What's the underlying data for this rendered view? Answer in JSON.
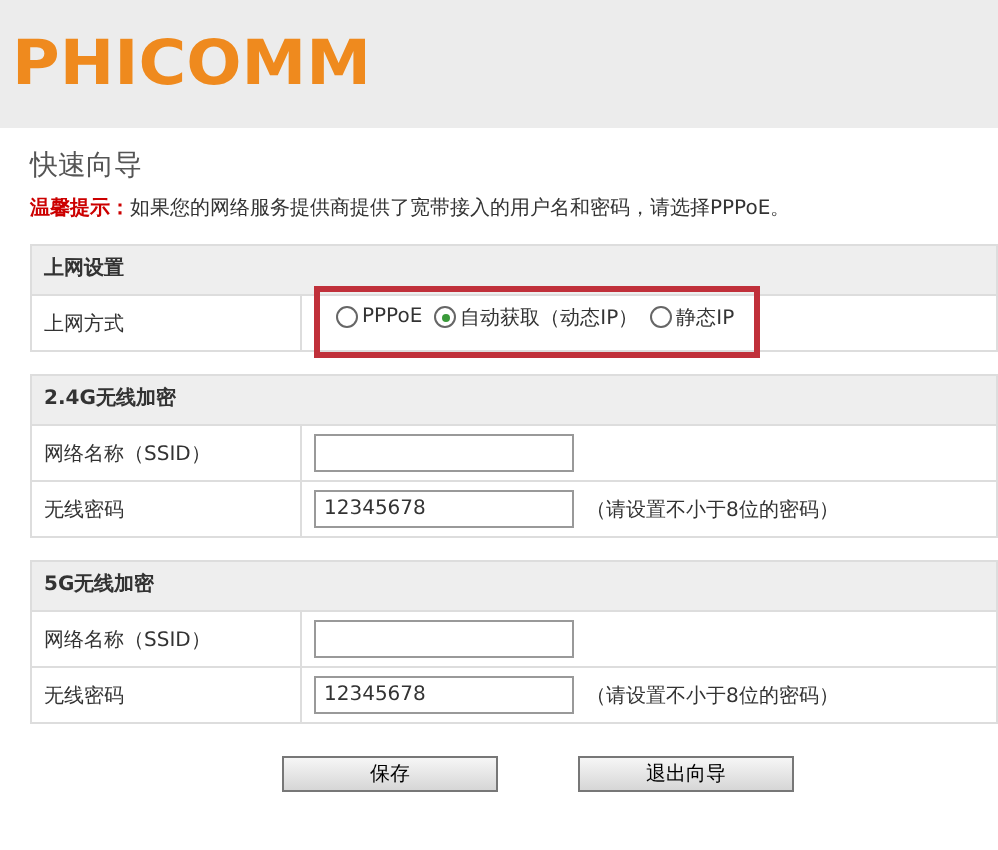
{
  "logo": "PHICOMM",
  "title": "快速向导",
  "notice": "**温馨提示：**如果您的网络服务提供商提供了宽带接入的用户名和密码，请选择PPPoE。",
  "sections": [
    {
      "heading": "上网设置",
      "rows": [
        {
          "kind": "radios",
          "label": "上网方式",
          "highlighted": true,
          "options": [
            {
              "label": "PPPoE",
              "selected": false
            },
            {
              "label": "自动获取（动态IP）",
              "selected": true
            },
            {
              "label": "静态IP",
              "selected": false
            }
          ]
        }
      ]
    },
    {
      "heading": "2.4G无线加密",
      "rows": [
        {
          "kind": "input",
          "label": "网络名称（SSID）"
        },
        {
          "kind": "input",
          "label": "无线密码",
          "value": "12345678",
          "hint": "（请设置不小于8位的密码）"
        }
      ]
    },
    {
      "heading": "5G无线加密",
      "rows": [
        {
          "kind": "input",
          "label": "网络名称（SSID）"
        },
        {
          "kind": "input",
          "label": "无线密码",
          "value": "12345678",
          "hint": "（请设置不小于8位的密码）"
        }
      ]
    }
  ],
  "buttons": [
    "保存",
    "退出向导"
  ]
}
